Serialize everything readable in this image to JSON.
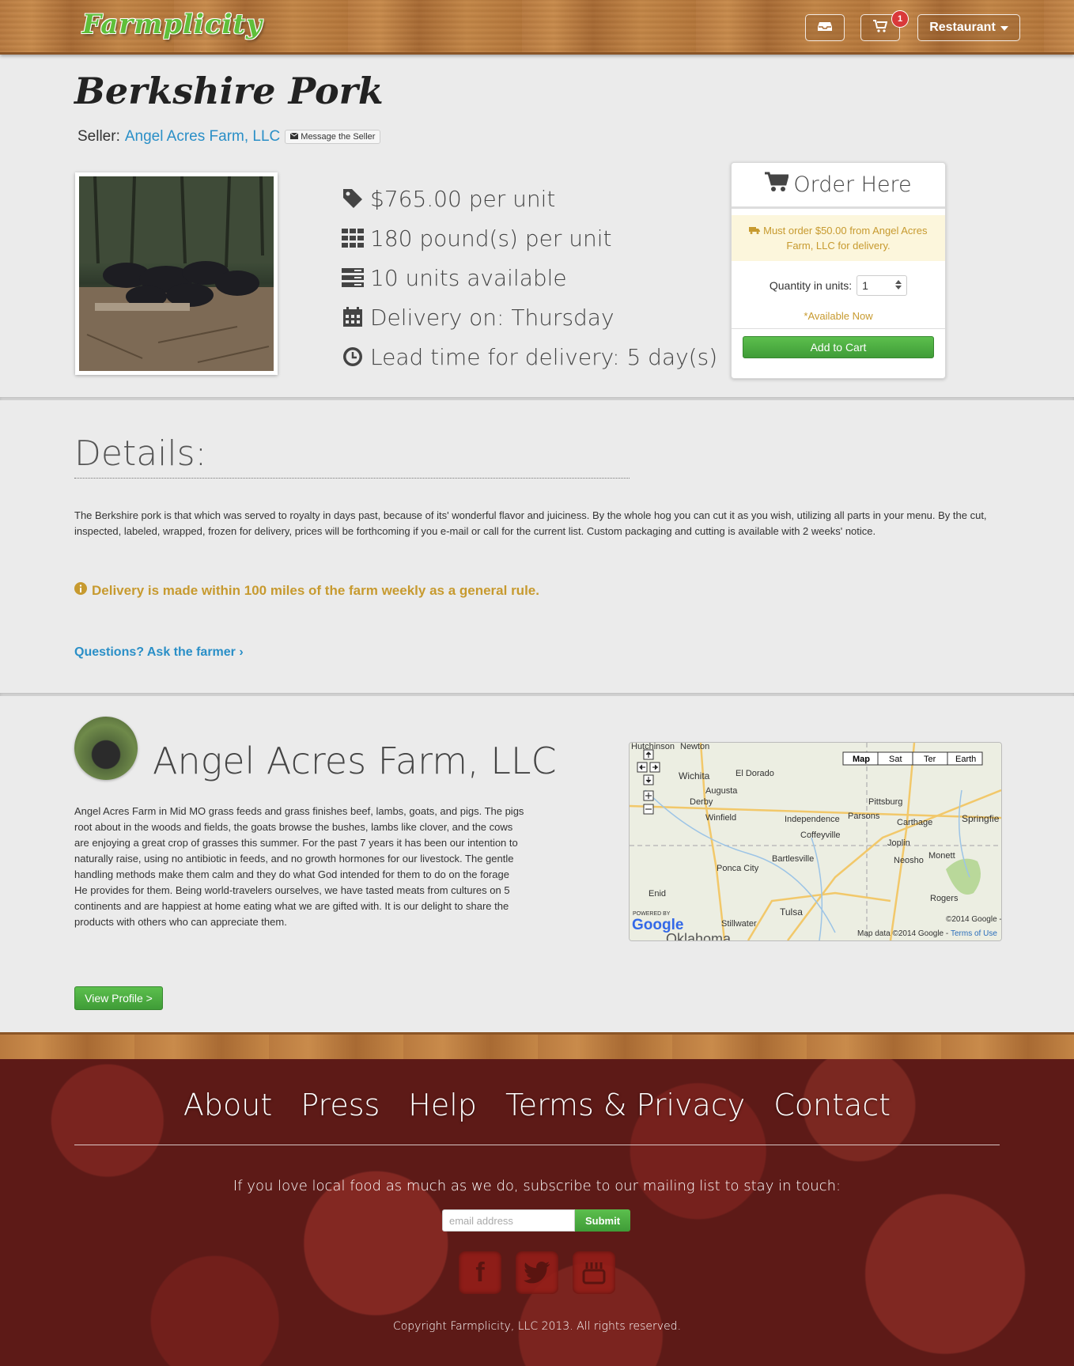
{
  "header": {
    "logo": "Farmplicity",
    "cart_badge": "1",
    "account_label": "Restaurant"
  },
  "product": {
    "title": "Berkshire Pork",
    "seller_prefix": "Seller:",
    "seller_name": "Angel Acres Farm, LLC",
    "message_seller": "Message the Seller",
    "price": "$765.00 per unit",
    "weight": "180 pound(s) per unit",
    "units": "10 units available",
    "delivery_day": "Delivery on: Thursday",
    "lead_time": "Lead time for delivery: 5 day(s)"
  },
  "order": {
    "heading": "Order Here",
    "warning": "Must order $50.00 from Angel Acres Farm, LLC for delivery.",
    "quantity_label": "Quantity in units:",
    "quantity_value": "1",
    "availability": "*Available Now",
    "add_to_cart": "Add to Cart"
  },
  "details": {
    "heading": "Details:",
    "text": "The Berkshire pork is that which was served to royalty in days past, because of its' wonderful flavor and juiciness. By the whole hog you can cut it as you wish, utilizing all parts in your menu. By the cut, inspected, labeled, wrapped, frozen for delivery, prices will be forthcoming if you e-mail or call for the current list. Custom packaging and cutting is available with 2 weeks' notice.",
    "delivery_note": "Delivery is made within 100 miles of the farm weekly as a general rule.",
    "ask_link": "Questions? Ask the farmer ›"
  },
  "farm": {
    "name": "Angel Acres Farm, LLC",
    "description": "Angel Acres Farm in Mid MO grass feeds and grass finishes beef, lambs, goats, and pigs. The pigs root about in the woods and fields, the goats browse the bushes, lambs like clover, and the cows are enjoying a great crop of grasses this summer. For the past 7 years it has been our intention to naturally raise, using no antibiotic in feeds, and no growth hormones for our livestock. The gentle handling methods make them calm and they do what God intended for them to do on the forage He provides for them. Being world-travelers ourselves, we have tasted meats from cultures on 5 continents and are happiest at home eating what we are gifted with. It is our delight to share the products with others who can appreciate them.",
    "view_profile": "View Profile >"
  },
  "map": {
    "types": [
      "Map",
      "Sat",
      "Ter",
      "Earth"
    ],
    "cities": [
      "Hutchinson",
      "Newton",
      "Wichita",
      "El Dorado",
      "Augusta",
      "Derby",
      "Winfield",
      "Independence",
      "Parsons",
      "Pittsburg",
      "Carthage",
      "Springfie",
      "Coffeyville",
      "Joplin",
      "Bartlesville",
      "Neosho",
      "Monett",
      "Ponca City",
      "Enid",
      "Rogers",
      "Stillwater",
      "Tulsa",
      "Oklahoma"
    ],
    "powered_by": "POWERED BY",
    "google_logo": "Google",
    "attribution": "©2014 Google -",
    "map_data": "Map data ©2014 Google -",
    "terms": "Terms of Use"
  },
  "footer": {
    "nav": [
      "About",
      "Press",
      "Help",
      "Terms & Privacy",
      "Contact"
    ],
    "subscribe_text": "If you love local food as much as we do, subscribe to our mailing list to stay in touch:",
    "email_placeholder": "email address",
    "submit": "Submit",
    "copyright": "Copyright Farmplicity, LLC 2013. All rights reserved."
  }
}
